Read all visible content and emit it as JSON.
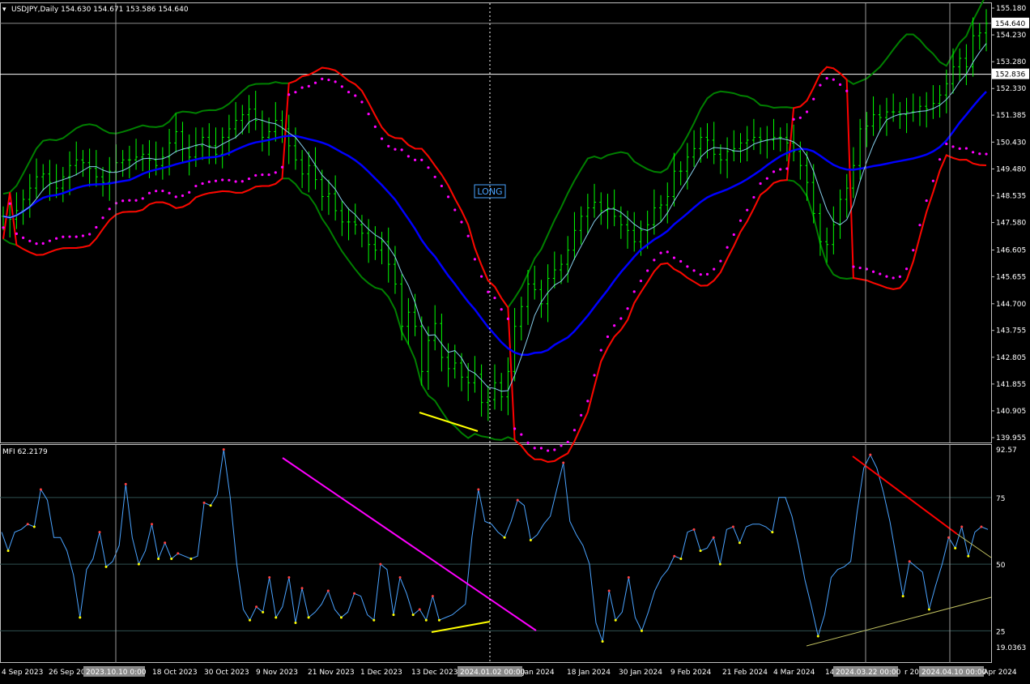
{
  "chart_data": [
    {
      "type": "line",
      "name": "price-panel",
      "header": "USDJPY,Daily  154.630 154.671 153.586 154.640",
      "y_ticks": [
        "155.180",
        "154.230",
        "153.280",
        "152.330",
        "151.385",
        "150.430",
        "149.480",
        "148.535",
        "147.580",
        "146.605",
        "145.655",
        "144.700",
        "143.755",
        "142.805",
        "141.855",
        "140.905",
        "139.955"
      ],
      "ylim": [
        139.955,
        155.18
      ],
      "price_label": "154.640",
      "hline_label": "152.836",
      "annotation": "LONG",
      "x_ticks": [
        "4 Sep 2023",
        "26 Sep 2023",
        "18 Oct 2023",
        "30 Oct 2023",
        "9 Nov 2023",
        "21 Nov 2023",
        "1 Dec 2023",
        "13 Dec 2023",
        "Jan 2024",
        "18 Jan 2024",
        "30 Jan 2024",
        "9 Feb 2024",
        "21 Feb 2024",
        "4 Mar 2024",
        "Mar 2024",
        "Apr 2024"
      ],
      "x_ticks_shown": [
        "4 Sep 2023",
        "26 Sep 20",
        "18 Oct 2023",
        "30 Oct 2023",
        "9 Nov 2023",
        "21 Nov 2023",
        "1 Dec 2023",
        "13 Dec 2023",
        "Jan 2024",
        "18 Jan 2024",
        "30 Jan 2024",
        "9 Feb 2024",
        "21 Feb 2024",
        "4 Mar 2024",
        "14",
        "r 2024",
        "17 Apr 2024"
      ],
      "crosshair_labels": [
        "2023.10.10 0:00",
        "2024.01.02 00:00",
        "2024.03.22 00:00",
        "2024.04.10 00:00"
      ],
      "series": [
        {
          "name": "Close",
          "color": "#00ff00",
          "values": [
            147.8,
            147.7,
            148.0,
            148.4,
            148.8,
            149.2,
            149.3,
            149.0,
            148.8,
            149.2,
            149.6,
            149.8,
            149.7,
            149.5,
            149.2,
            149.0,
            149.4,
            149.7,
            149.8,
            149.8,
            149.9,
            150.0,
            149.8,
            149.6,
            149.9,
            150.4,
            150.8,
            150.2,
            149.9,
            150.3,
            150.6,
            150.3,
            150.0,
            150.6,
            150.9,
            151.2,
            151.4,
            151.6,
            151.2,
            150.6,
            150.8,
            151.2,
            150.9,
            150.3,
            149.8,
            149.3,
            149.6,
            149.1,
            148.5,
            148.6,
            148.0,
            147.6,
            147.6,
            147.5,
            147.2,
            146.8,
            146.6,
            146.9,
            146.1,
            145.4,
            143.9,
            144.4,
            143.9,
            142.3,
            143.4,
            144.0,
            142.8,
            142.4,
            142.6,
            142.1,
            141.9,
            142.2,
            141.2,
            141.3,
            141.9,
            141.4,
            142.3,
            143.9,
            144.6,
            145.4,
            145.2,
            144.7,
            145.6,
            145.9,
            146.1,
            146.6,
            147.3,
            147.8,
            148.1,
            148.3,
            148.0,
            148.1,
            147.8,
            147.5,
            147.3,
            146.9,
            147.3,
            147.5,
            148.1,
            148.2,
            148.5,
            149.4,
            149.4,
            149.9,
            150.2,
            150.6,
            150.5,
            150.0,
            149.8,
            150.1,
            150.2,
            150.4,
            150.5,
            150.6,
            150.5,
            150.5,
            150.6,
            150.6,
            150.4,
            150.1,
            149.6,
            149.0,
            147.9,
            146.9,
            146.8,
            147.5,
            148.4,
            148.8,
            149.6,
            150.9,
            151.0,
            151.4,
            151.3,
            151.5,
            151.5,
            151.4,
            151.5,
            151.5,
            151.7,
            151.6,
            151.8,
            152.1,
            152.5,
            153.1,
            153.4,
            153.1,
            154.2,
            154.3,
            154.64
          ]
        },
        {
          "name": "MA fast",
          "color": "#87ceeb",
          "values": []
        },
        {
          "name": "MA slow",
          "color": "#0000ff",
          "values": []
        },
        {
          "name": "Bollinger upper",
          "color": "#008000",
          "values": []
        },
        {
          "name": "Bollinger lower",
          "color": "#008000",
          "values": []
        },
        {
          "name": "Envelope",
          "color": "#ff0000",
          "values": []
        },
        {
          "name": "Parabolic SAR",
          "color": "#ff00ff",
          "values": []
        }
      ]
    },
    {
      "type": "line",
      "name": "mfi-panel",
      "header": "MFI 62.2179",
      "y_ticks": [
        "92.57",
        "75",
        "50",
        "25",
        "19.0363"
      ],
      "ylim": [
        19.0363,
        92.57
      ],
      "series": [
        {
          "name": "MFI",
          "color": "#4aa3ff",
          "values": [
            62,
            55,
            62,
            63,
            65,
            64,
            78,
            74,
            60,
            60,
            55,
            46,
            30,
            48,
            52,
            62,
            49,
            51,
            57,
            80,
            60,
            50,
            55,
            65,
            52,
            58,
            52,
            54,
            53,
            52,
            53,
            73,
            72,
            76,
            93,
            75,
            50,
            33,
            29,
            34,
            32,
            45,
            30,
            34,
            45,
            28,
            41,
            30,
            32,
            35,
            40,
            33,
            30,
            32,
            39,
            38,
            31,
            29,
            50,
            48,
            31,
            45,
            39,
            31,
            33,
            29,
            38,
            29,
            30,
            31,
            33,
            35,
            60,
            78,
            66,
            65,
            62,
            60,
            66,
            74,
            72,
            59,
            61,
            65,
            68,
            78,
            88,
            66,
            61,
            57,
            50,
            28,
            21,
            40,
            29,
            32,
            45,
            30,
            25,
            32,
            40,
            45,
            48,
            53,
            52,
            62,
            63,
            55,
            56,
            60,
            50,
            63,
            64,
            58,
            64,
            65,
            65,
            64,
            62,
            75,
            75,
            68,
            57,
            44,
            34,
            23,
            31,
            45,
            48,
            49,
            51,
            70,
            86,
            91,
            86,
            77,
            66,
            52,
            38,
            51,
            49,
            47,
            33,
            42,
            50,
            60,
            56,
            64,
            53,
            62,
            64,
            63
          ]
        },
        {
          "name": "Levels",
          "color": "#2f4f4f",
          "values": [
            75,
            50,
            25
          ]
        }
      ]
    }
  ],
  "colors": {
    "background": "#000000",
    "grid": "#555555",
    "candle": "#00ff00",
    "ma_fast": "#87ceeb",
    "ma_slow": "#0000ff",
    "bb": "#008000",
    "env": "#ff0000",
    "sar": "#ff00ff",
    "mfi": "#4aa3ff",
    "trend_magenta": "#ff00ff",
    "trend_yellow": "#ffff00",
    "trend_red": "#ff0000",
    "trend_olive": "#c0c060"
  }
}
